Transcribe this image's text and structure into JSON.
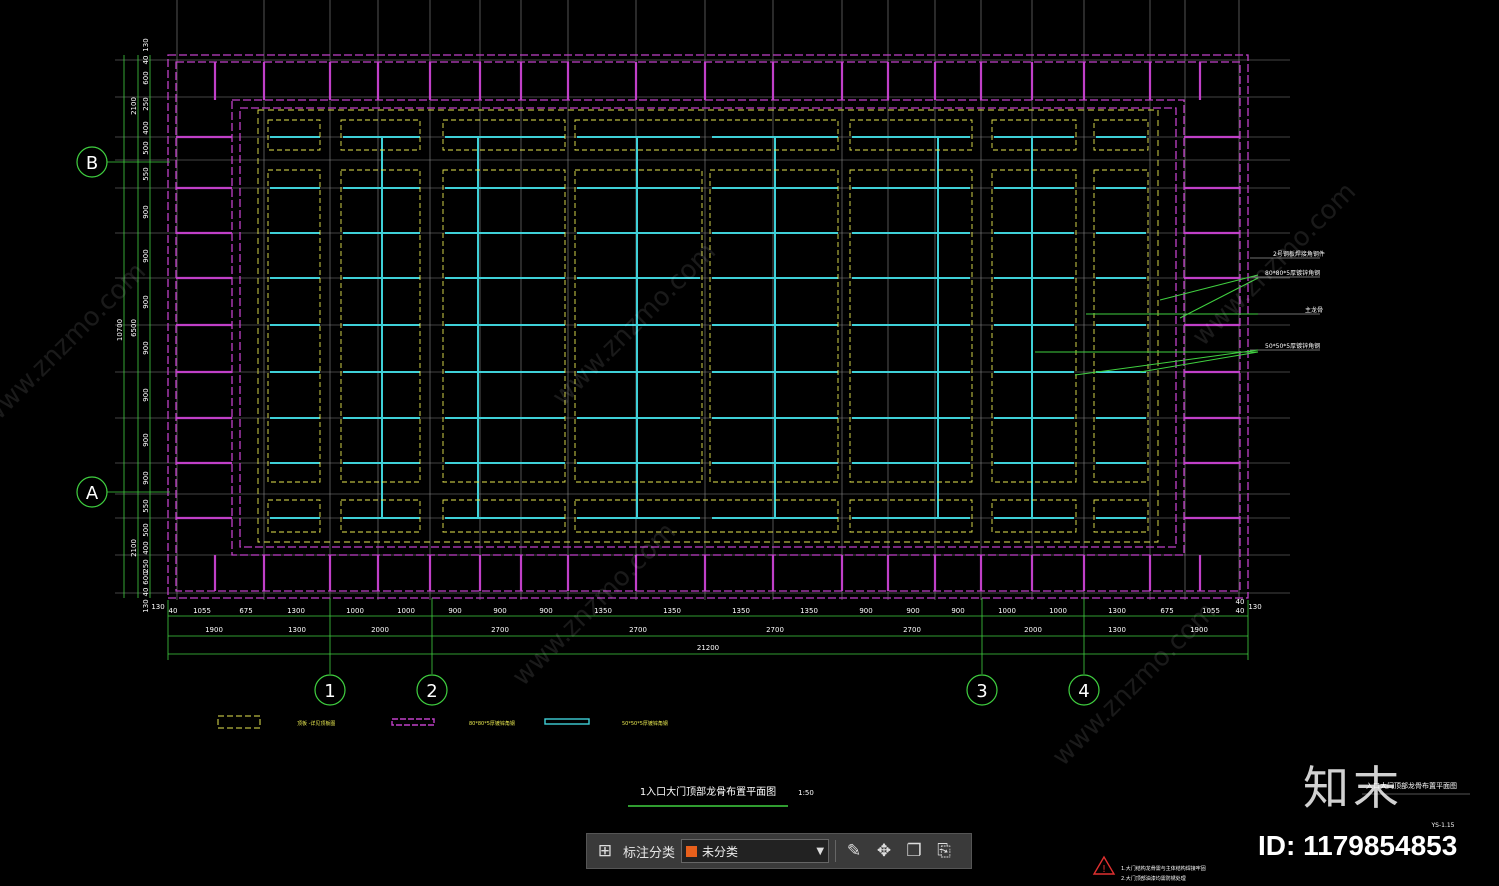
{
  "drawing": {
    "title": "1入口大门顶部龙骨布置平面图",
    "scale": "1:50",
    "side_note": "入口大门顶部龙骨布置平面图",
    "sheet_no": "YS-1.15",
    "annotations": [
      "2号钢板焊接角钢件",
      "80*80*5厚镀锌角钢",
      "主龙骨",
      "50*50*5厚镀锌角钢"
    ],
    "legend": [
      "顶板 -详见顶板图",
      "80*80*5厚镀锌角钢",
      "50*50*5厚镀锌角钢"
    ],
    "notes": [
      "1.大门结构龙骨需与主体结构焊接牢固",
      "2.大门顶部油漆均需防锈处理"
    ],
    "axes_v": [
      "1",
      "2",
      "3",
      "4"
    ],
    "axes_h": [
      "B",
      "A"
    ],
    "dims_top": [
      "40",
      "1055",
      "675",
      "1300",
      "1000",
      "1000",
      "900",
      "900",
      "900",
      "1350",
      "1350",
      "1350",
      "1350",
      "900",
      "900",
      "900",
      "1000",
      "1000",
      "1300",
      "675",
      "1055",
      "40"
    ],
    "dims_mid": [
      "1900",
      "1300",
      "2000",
      "2700",
      "2700",
      "2700",
      "2700",
      "2000",
      "1300",
      "1900"
    ],
    "dim_total": "21200",
    "dims_left": [
      "130",
      "40",
      "600",
      "250",
      "400",
      "500",
      "550",
      "900",
      "900",
      "900",
      "900",
      "900",
      "900",
      "900",
      "550",
      "500",
      "400",
      "250",
      "600",
      "40",
      "130"
    ],
    "dims_left_outer": [
      "2100",
      "6500",
      "2100"
    ],
    "dim_left_total": "10700",
    "edge_130_left": "130",
    "edge_130_right": "130",
    "edge_40_right": "40"
  },
  "toolbar": {
    "label": "标注分类",
    "category_value": "未分类",
    "category_color": "#e8601c"
  },
  "watermark": {
    "logo": "知末",
    "id_text": "ID: 1179854853",
    "site_text": "www.znzmo.com"
  },
  "colors": {
    "magenta": "#c040c8",
    "cyan": "#3fd0d8",
    "yellow": "#e8e850",
    "green": "#40d040",
    "grey": "#8a8a8a"
  }
}
